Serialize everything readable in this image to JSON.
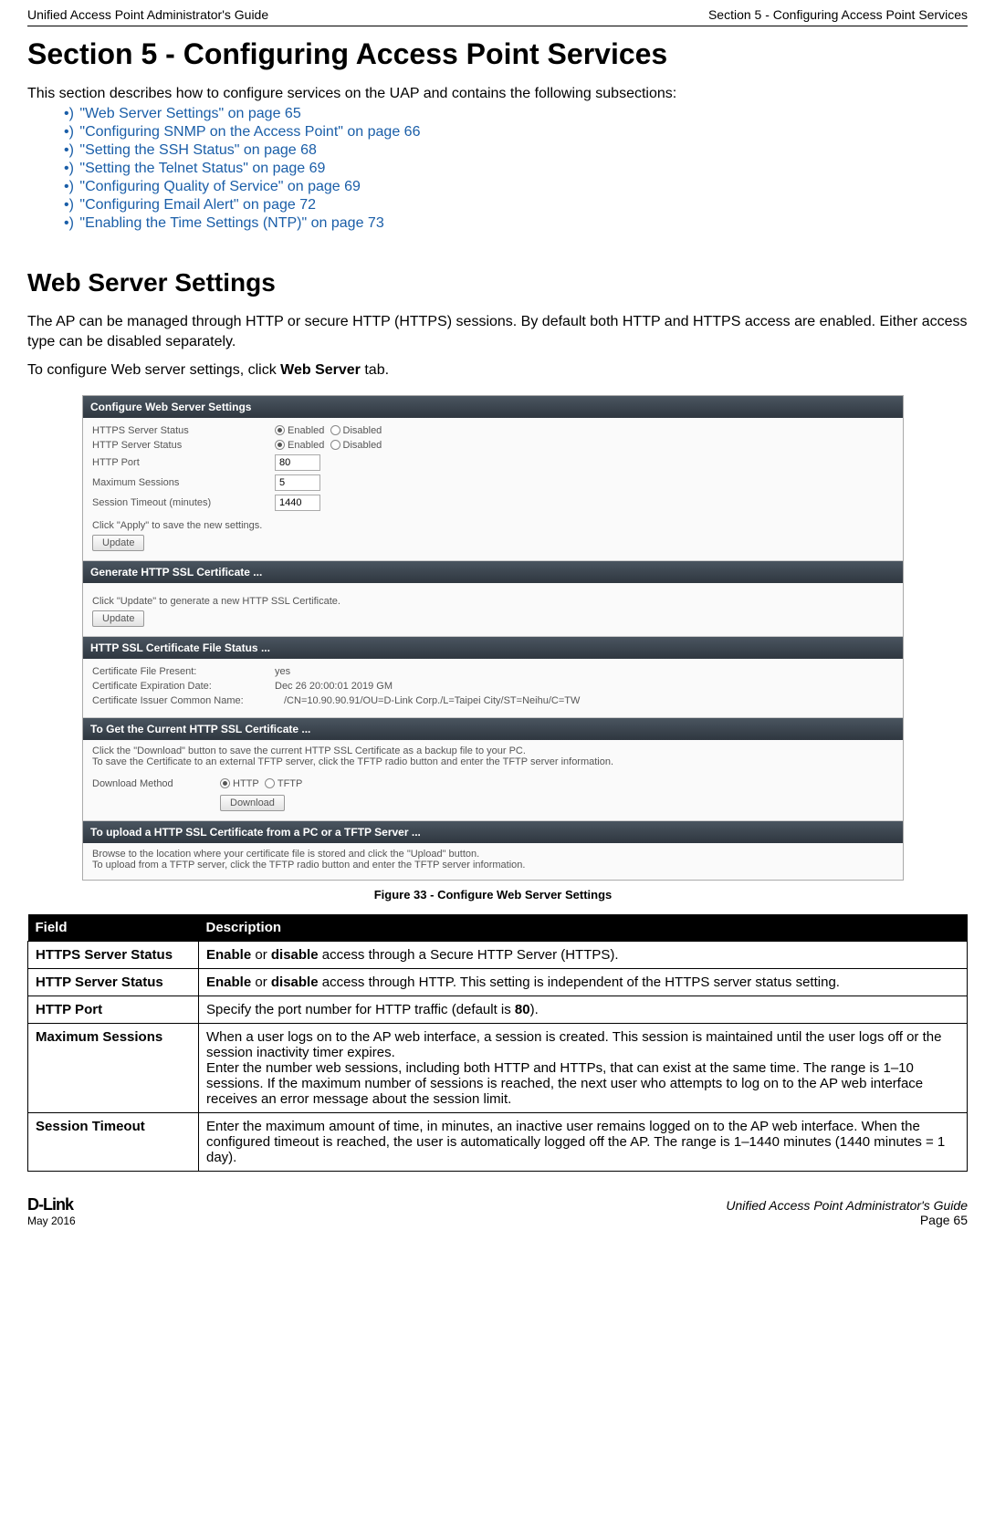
{
  "header": {
    "left": "Unified Access Point Administrator's Guide",
    "right": "Section 5 - Configuring Access Point Services"
  },
  "title": "Section 5 - Configuring Access Point Services",
  "intro": "This section describes how to configure services on the UAP and contains the following subsections:",
  "links": [
    "\"Web Server Settings\" on page 65",
    "\"Configuring SNMP on the Access Point\" on page 66",
    "\"Setting the SSH Status\" on page 68",
    "\"Setting the Telnet Status\" on page 69",
    "\"Configuring Quality of Service\" on page 69",
    "\"Configuring Email Alert\" on page 72",
    "\"Enabling the Time Settings (NTP)\" on page 73"
  ],
  "sub_heading": "Web Server Settings",
  "para1": "The AP can be managed through HTTP or secure HTTP (HTTPS) sessions. By default both HTTP and HTTPS access are enabled. Either access type can be disabled separately.",
  "para2_pre": "To configure Web server settings, click ",
  "para2_bold": "Web Server",
  "para2_post": " tab.",
  "screenshot": {
    "titlebar": "Configure Web Server Settings",
    "rows": {
      "https_label": "HTTPS Server Status",
      "http_label": "HTTP Server Status",
      "enabled": "Enabled",
      "disabled": "Disabled",
      "http_port_label": "HTTP Port",
      "http_port_value": "80",
      "max_sessions_label": "Maximum Sessions",
      "max_sessions_value": "5",
      "session_timeout_label": "Session Timeout (minutes)",
      "session_timeout_value": "1440"
    },
    "apply_note": "Click \"Apply\" to save the new settings.",
    "update_btn": "Update",
    "gen_cert_header": "Generate HTTP SSL Certificate ...",
    "gen_cert_note": "Click \"Update\" to generate a new HTTP SSL Certificate.",
    "cert_status_header": "HTTP SSL Certificate File Status ...",
    "cert_present_label": "Certificate File Present:",
    "cert_present_value": "yes",
    "cert_exp_label": "Certificate Expiration Date:",
    "cert_exp_value": "Dec 26 20:00:01 2019 GM",
    "cert_issuer_label": "Certificate Issuer Common Name:",
    "cert_issuer_value": "/CN=10.90.90.91/OU=D-Link Corp./L=Taipei City/ST=Neihu/C=TW",
    "get_cert_header": "To Get the Current HTTP SSL Certificate ...",
    "get_cert_note1": "Click the \"Download\" button to save the current HTTP SSL Certificate as a backup file to your PC.",
    "get_cert_note2": "To save the Certificate to an external TFTP server, click the TFTP radio button and enter the TFTP server information.",
    "download_method_label": "Download Method",
    "http_opt": "HTTP",
    "tftp_opt": "TFTP",
    "download_btn": "Download",
    "upload_header": "To upload a HTTP SSL Certificate from a PC or a TFTP Server ...",
    "upload_note1": "Browse to the location where your certificate file is stored and click the \"Upload\" button.",
    "upload_note2": "To upload from a TFTP server, click the TFTP radio button and enter the TFTP server information."
  },
  "figure_caption": "Figure 33 - Configure Web Server Settings",
  "table": {
    "h_field": "Field",
    "h_desc": "Description",
    "rows": [
      {
        "field": "HTTPS Server Status",
        "desc_pre": "",
        "desc_b1": "Enable",
        "desc_mid": " or ",
        "desc_b2": "disable",
        "desc_post": " access through a Secure HTTP Server (HTTPS)."
      },
      {
        "field": "HTTP Server Status",
        "desc_pre": "",
        "desc_b1": "Enable",
        "desc_mid": " or ",
        "desc_b2": "disable",
        "desc_post": " access through HTTP. This setting is independent of the HTTPS server status setting."
      },
      {
        "field": "HTTP Port",
        "desc_plain_pre": "Specify the port number for HTTP traffic (default is ",
        "desc_plain_bold": "80",
        "desc_plain_post": ")."
      },
      {
        "field": "Maximum Sessions",
        "desc_full": "When a user logs on to the AP web interface, a session is created. This session is maintained until the user logs off or the session inactivity timer expires.\nEnter the number web sessions, including both HTTP and HTTPs, that can exist at the same time. The range is 1–10 sessions. If the maximum number of sessions is reached, the next user who attempts to log on to the AP web interface receives an error message about the session limit."
      },
      {
        "field": "Session Timeout",
        "desc_full": "Enter the maximum amount of time, in minutes, an inactive user remains logged on to the AP web interface. When the configured timeout is reached, the user is automatically logged off the AP. The range is 1–1440 minutes (1440 minutes = 1 day)."
      }
    ]
  },
  "footer": {
    "logo": "D-Link",
    "date": "May 2016",
    "guide": "Unified Access Point Administrator's Guide",
    "page": "Page 65"
  }
}
